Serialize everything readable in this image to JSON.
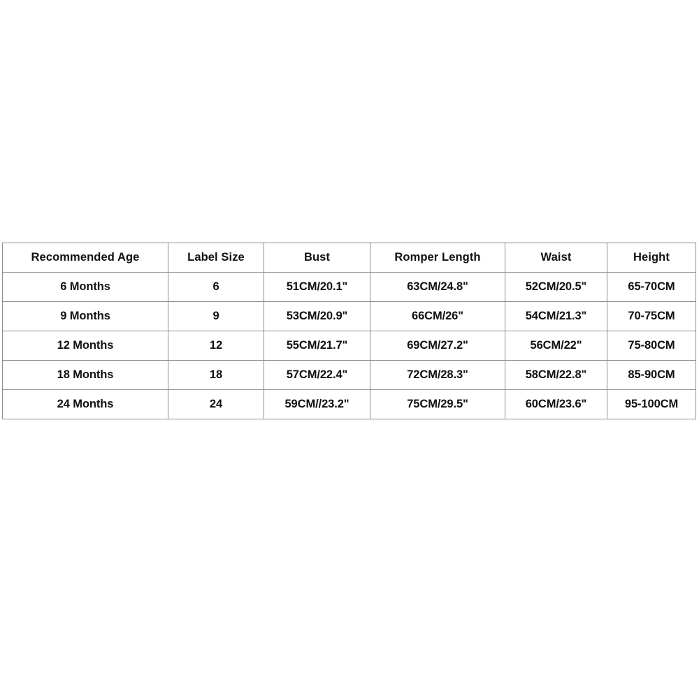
{
  "page": {
    "background_color": "#ffffff",
    "text_color": "#111111",
    "border_color": "#8c8c8c"
  },
  "size_chart": {
    "columns": [
      "Recommended Age",
      "Label Size",
      "Bust",
      "Romper Length",
      "Waist",
      "Height"
    ],
    "rows": [
      {
        "recommended_age": "6 Months",
        "label_size": "6",
        "bust": "51CM/20.1\"",
        "romper_length": "63CM/24.8\"",
        "waist": "52CM/20.5\"",
        "height": "65-70CM"
      },
      {
        "recommended_age": "9 Months",
        "label_size": "9",
        "bust": "53CM/20.9\"",
        "romper_length": "66CM/26\"",
        "waist": "54CM/21.3\"",
        "height": "70-75CM"
      },
      {
        "recommended_age": "12 Months",
        "label_size": "12",
        "bust": "55CM/21.7\"",
        "romper_length": "69CM/27.2\"",
        "waist": "56CM/22\"",
        "height": "75-80CM"
      },
      {
        "recommended_age": "18 Months",
        "label_size": "18",
        "bust": "57CM/22.4\"",
        "romper_length": "72CM/28.3\"",
        "waist": "58CM/22.8\"",
        "height": "85-90CM"
      },
      {
        "recommended_age": "24 Months",
        "label_size": "24",
        "bust": "59CM//23.2\"",
        "romper_length": "75CM/29.5\"",
        "waist": "60CM/23.6\"",
        "height": "95-100CM"
      }
    ]
  }
}
